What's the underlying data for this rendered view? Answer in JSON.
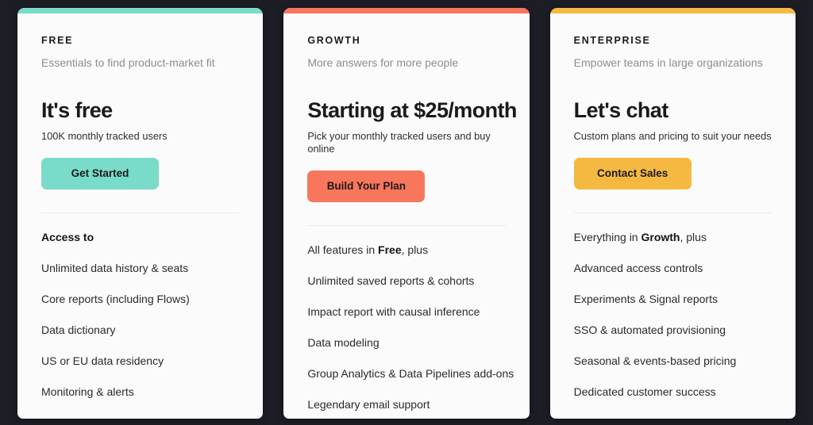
{
  "page": {
    "background_color": "#1d1d26",
    "card_background": "#fbfbfb"
  },
  "plans": [
    {
      "accent_color": "#79dbc9",
      "label": "FREE",
      "tagline": "Essentials to find product-market fit",
      "headline": "It's free",
      "subline": "100K monthly tracked users",
      "cta_label": "Get Started",
      "features_heading": "Access to",
      "features_heading_html": "Access to",
      "features": [
        "Unlimited data history & seats",
        "Core reports (including Flows)",
        "Data dictionary",
        "US or EU data residency",
        "Monitoring & alerts"
      ]
    },
    {
      "accent_color": "#f8765b",
      "label": "GROWTH",
      "tagline": "More answers for more people",
      "headline": "Starting at $25/month",
      "subline": "Pick your monthly tracked users and buy online",
      "cta_label": "Build Your Plan",
      "features_heading": "All features in Free, plus",
      "features_heading_html": "All features in <b>Free</b>, plus",
      "features": [
        "Unlimited saved reports & cohorts",
        "Impact report with causal inference",
        "Data modeling",
        "Group Analytics & Data Pipelines add-ons",
        "Legendary email support"
      ]
    },
    {
      "accent_color": "#f5b941",
      "label": "ENTERPRISE",
      "tagline": "Empower teams in large organizations",
      "headline": "Let's chat",
      "subline": "Custom plans and pricing to suit your needs",
      "cta_label": "Contact Sales",
      "features_heading": "Everything in Growth, plus",
      "features_heading_html": "Everything in <b>Growth</b>, plus",
      "features": [
        "Advanced access controls",
        "Experiments & Signal reports",
        "SSO & automated provisioning",
        "Seasonal & events-based pricing",
        "Dedicated customer success"
      ]
    }
  ]
}
